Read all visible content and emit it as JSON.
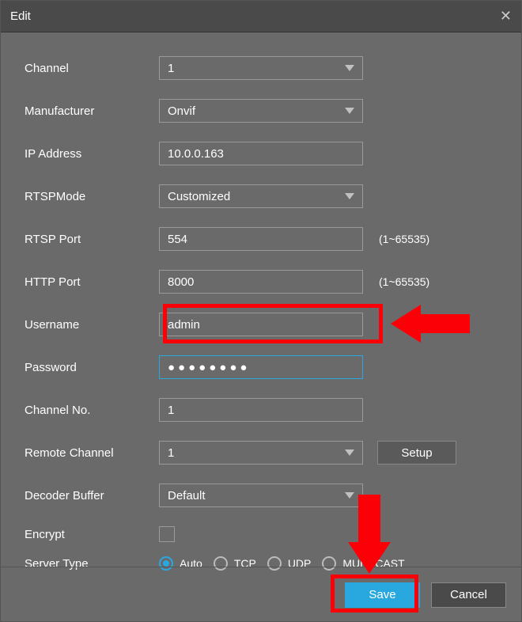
{
  "title": "Edit",
  "fields": {
    "channel": {
      "label": "Channel",
      "value": "1",
      "type": "select"
    },
    "manufacturer": {
      "label": "Manufacturer",
      "value": "Onvif",
      "type": "select"
    },
    "ip": {
      "label": "IP Address",
      "value": "10.0.0.163",
      "type": "text"
    },
    "rtspmode": {
      "label": "RTSPMode",
      "value": "Customized",
      "type": "select"
    },
    "rtspport": {
      "label": "RTSP Port",
      "value": "554",
      "type": "text",
      "hint": "(1~65535)"
    },
    "httpport": {
      "label": "HTTP Port",
      "value": "8000",
      "type": "text",
      "hint": "(1~65535)"
    },
    "username": {
      "label": "Username",
      "value": "admin",
      "type": "text"
    },
    "password": {
      "label": "Password",
      "value": "●●●●●●●●",
      "type": "text"
    },
    "channelno": {
      "label": "Channel No.",
      "value": "1",
      "type": "text"
    },
    "remotechannel": {
      "label": "Remote Channel",
      "value": "1",
      "type": "select"
    },
    "decoderbuffer": {
      "label": "Decoder Buffer",
      "value": "Default",
      "type": "select"
    },
    "encrypt": {
      "label": "Encrypt",
      "checked": false,
      "type": "checkbox"
    },
    "servertype": {
      "label": "Server Type",
      "type": "radios",
      "selected": "Auto",
      "options": [
        "Auto",
        "TCP",
        "UDP",
        "MULTICAST"
      ]
    }
  },
  "buttons": {
    "setup": "Setup",
    "save": "Save",
    "cancel": "Cancel"
  }
}
